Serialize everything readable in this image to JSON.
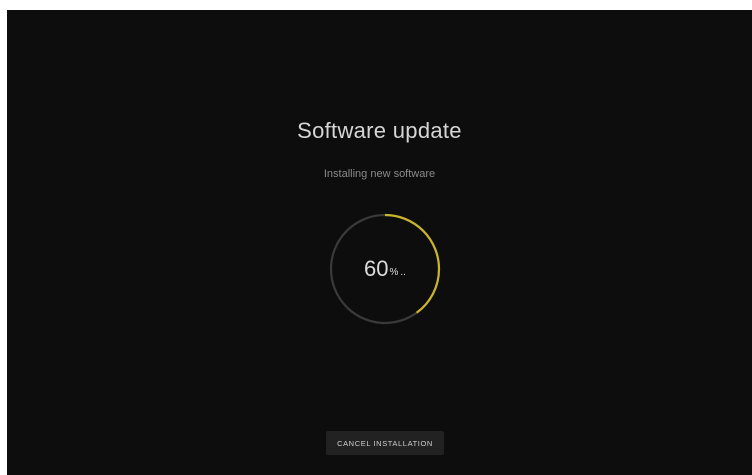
{
  "update": {
    "title": "Software update",
    "subtitle": "Installing new software"
  },
  "progress": {
    "value": "60",
    "unit": "%",
    "ellipsis": "..",
    "fraction": 0.6,
    "track_color": "#3a3a3a",
    "accent_color": "#c9b52a"
  },
  "actions": {
    "cancel_label": "CANCEL INSTALLATION"
  }
}
